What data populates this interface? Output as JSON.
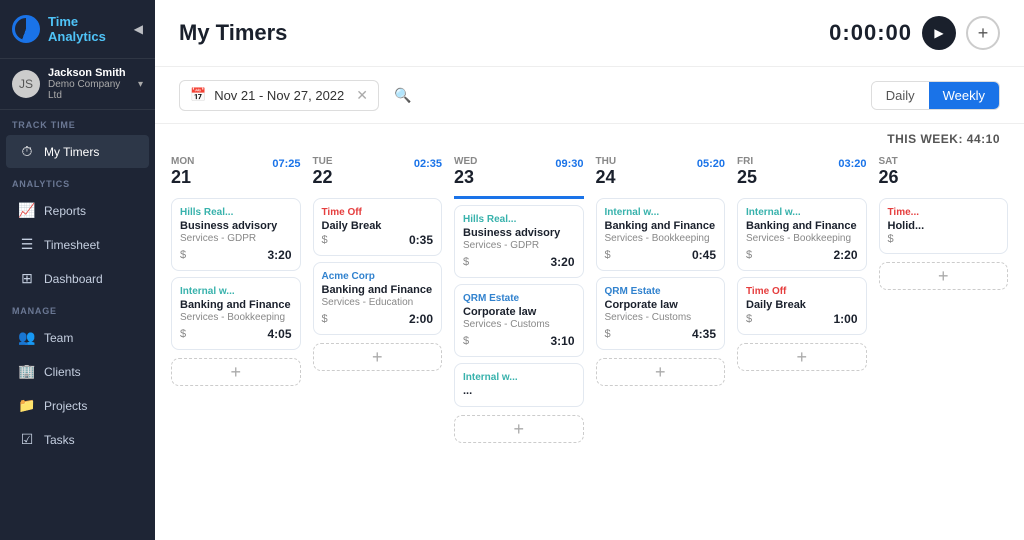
{
  "app": {
    "title": "Time Analytics",
    "logo_alt": "Time Analytics logo"
  },
  "sidebar": {
    "user": {
      "name": "Jackson Smith",
      "company": "Demo Company Ltd",
      "avatar_initials": "JS"
    },
    "sections": [
      {
        "label": "TRACK TIME",
        "items": [
          {
            "id": "my-timers",
            "label": "My Timers",
            "icon": "⏱",
            "active": true
          }
        ]
      },
      {
        "label": "ANALYTICS",
        "items": [
          {
            "id": "reports",
            "label": "Reports",
            "icon": "📈",
            "active": false
          },
          {
            "id": "timesheet",
            "label": "Timesheet",
            "icon": "☰",
            "active": false
          },
          {
            "id": "dashboard",
            "label": "Dashboard",
            "icon": "⊞",
            "active": false
          }
        ]
      },
      {
        "label": "MANAGE",
        "items": [
          {
            "id": "team",
            "label": "Team",
            "icon": "👥",
            "active": false
          },
          {
            "id": "clients",
            "label": "Clients",
            "icon": "🏢",
            "active": false
          },
          {
            "id": "projects",
            "label": "Projects",
            "icon": "📁",
            "active": false
          },
          {
            "id": "tasks",
            "label": "Tasks",
            "icon": "☑",
            "active": false
          }
        ]
      }
    ]
  },
  "header": {
    "page_title": "My Timers",
    "timer_display": "0:00:00",
    "play_btn_label": "▶",
    "add_btn_label": "+"
  },
  "toolbar": {
    "date_range": "Nov 21 - Nov 27, 2022",
    "daily_label": "Daily",
    "weekly_label": "Weekly"
  },
  "week_summary": {
    "label": "THIS WEEK: 44:10"
  },
  "calendar": {
    "days": [
      {
        "id": "mon",
        "name": "MON",
        "num": "21",
        "total": "07:25",
        "active": false,
        "cards": [
          {
            "client": "Hills Real...",
            "client_color": "teal",
            "title": "Business advisory",
            "service": "Services - GDPR",
            "time": "3:20",
            "has_dollar": true
          },
          {
            "client": "Internal w...",
            "client_color": "teal",
            "title": "Banking and Finance",
            "service": "Services - Bookkeeping",
            "time": "4:05",
            "has_dollar": true
          }
        ]
      },
      {
        "id": "tue",
        "name": "TUE",
        "num": "22",
        "total": "02:35",
        "active": false,
        "cards": [
          {
            "client": "Time Off",
            "client_color": "red",
            "title": "Daily Break",
            "service": "",
            "time": "0:35",
            "has_dollar": true
          },
          {
            "client": "Acme Corp",
            "client_color": "blue",
            "title": "Banking and Finance",
            "service": "Services - Education",
            "time": "2:00",
            "has_dollar": true
          }
        ]
      },
      {
        "id": "wed",
        "name": "WED",
        "num": "23",
        "total": "09:30",
        "active": true,
        "cards": [
          {
            "client": "Hills Real...",
            "client_color": "teal",
            "title": "Business advisory",
            "service": "Services - GDPR",
            "time": "3:20",
            "has_dollar": true
          },
          {
            "client": "QRM Estate",
            "client_color": "blue",
            "title": "Corporate law",
            "service": "Services - Customs",
            "time": "3:10",
            "has_dollar": true
          },
          {
            "client": "Internal w...",
            "client_color": "teal",
            "title": "...",
            "service": "",
            "time": "",
            "has_dollar": false
          }
        ]
      },
      {
        "id": "thu",
        "name": "THU",
        "num": "24",
        "total": "05:20",
        "active": false,
        "cards": [
          {
            "client": "Internal w...",
            "client_color": "teal",
            "title": "Banking and Finance",
            "service": "Services - Bookkeeping",
            "time": "0:45",
            "has_dollar": true
          },
          {
            "client": "QRM Estate",
            "client_color": "blue",
            "title": "Corporate law",
            "service": "Services - Customs",
            "time": "4:35",
            "has_dollar": true
          }
        ]
      },
      {
        "id": "fri",
        "name": "FRI",
        "num": "25",
        "total": "03:20",
        "active": false,
        "cards": [
          {
            "client": "Internal w...",
            "client_color": "teal",
            "title": "Banking and Finance",
            "service": "Services - Bookkeeping",
            "time": "2:20",
            "has_dollar": true
          },
          {
            "client": "Time Off",
            "client_color": "red",
            "title": "Daily Break",
            "service": "",
            "time": "1:00",
            "has_dollar": true
          }
        ]
      },
      {
        "id": "sat",
        "name": "SAT",
        "num": "26",
        "total": "",
        "active": false,
        "cards": [
          {
            "client": "Time...",
            "client_color": "red",
            "title": "Holid...",
            "service": "",
            "time": "",
            "has_dollar": true
          }
        ]
      }
    ]
  }
}
